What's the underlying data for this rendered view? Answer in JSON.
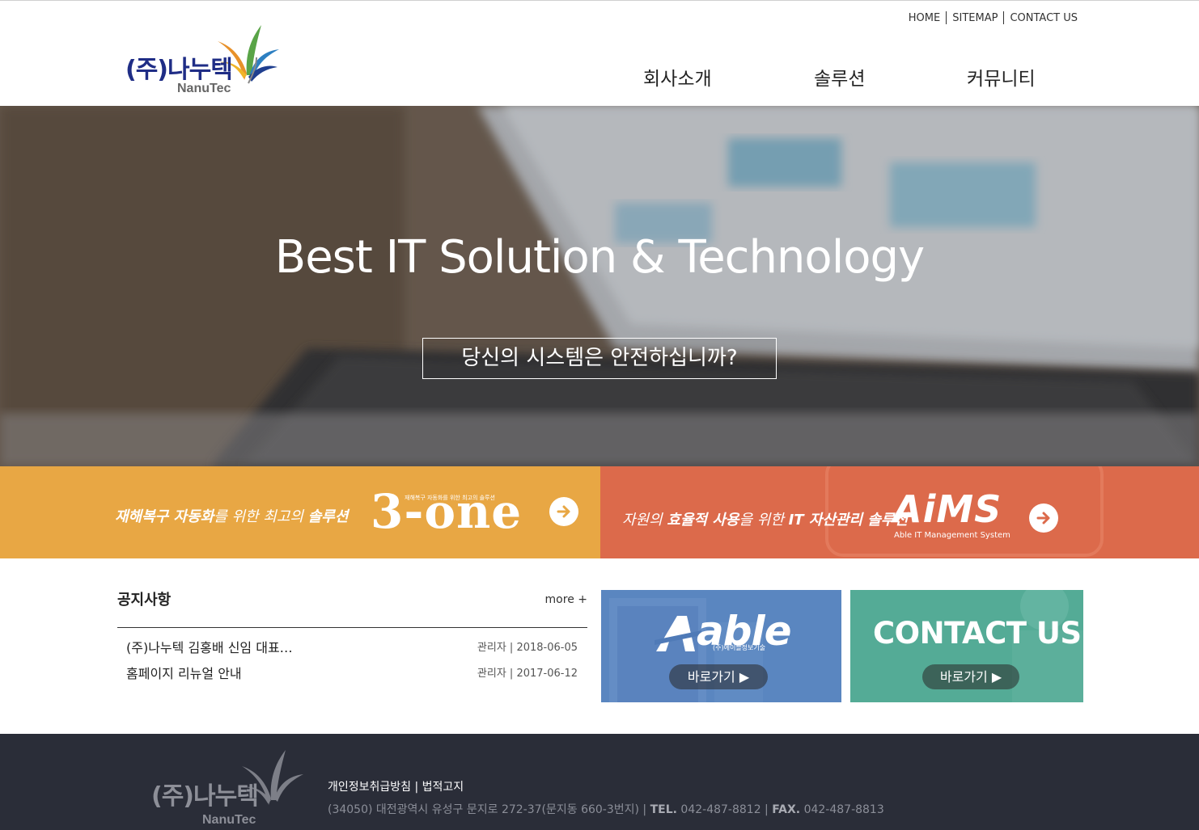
{
  "header": {
    "logo_text": "(주)나누텍",
    "logo_sub": "NanuTec",
    "util_links": [
      "HOME",
      "SITEMAP",
      "CONTACT US"
    ],
    "nav": [
      "회사소개",
      "솔루션",
      "커뮤니티"
    ]
  },
  "hero": {
    "title": "Best IT Solution & Technology",
    "button": "당신의 시스템은 안전하십니까?"
  },
  "banners": {
    "left": {
      "text_bold1": "재해복구 자동화",
      "text_mid": "를 위한 최고의 ",
      "text_bold2": "솔루션",
      "brand": "3-one",
      "brand_small": "재해복구 자동화를 위한 최고의 솔루션",
      "color": "#e8a744"
    },
    "right": {
      "text_pre": "자원의 ",
      "text_bold1": "효율적 사용",
      "text_mid": "을 위한 ",
      "text_bold2": "IT 자산관리 솔루션",
      "brand": "AiMS",
      "brand_sub": "Able IT Management System",
      "color": "#dc6a4b"
    }
  },
  "notice": {
    "title": "공지사항",
    "more": "more +",
    "items": [
      {
        "title": "(주)나누텍 김홍배 신임 대표…",
        "meta": "관리자 | 2018-06-05"
      },
      {
        "title": "홈페이지 리뉴얼 안내",
        "meta": "관리자 | 2017-06-12"
      }
    ]
  },
  "promos": {
    "able": {
      "logo": "able",
      "sub": "(주)에이블정보기술",
      "button": "바로가기 ▶",
      "color": "#4f7ab7"
    },
    "contact": {
      "title": "CONTACT US",
      "button": "바로가기 ▶",
      "color": "#4aa38e"
    }
  },
  "footer": {
    "logo_text": "(주)나누텍",
    "logo_sub": "NanuTec",
    "link1": "개인정보취급방침",
    "link_sep": "|",
    "link2": "법적고지",
    "address": "(34050) 대전광역시 유성구 문지로 272-37(문지동 660-3번지) | ",
    "tel_label": "TEL.",
    "tel": " 042-487-8812 | ",
    "fax_label": "FAX.",
    "fax": " 042-487-8813"
  }
}
